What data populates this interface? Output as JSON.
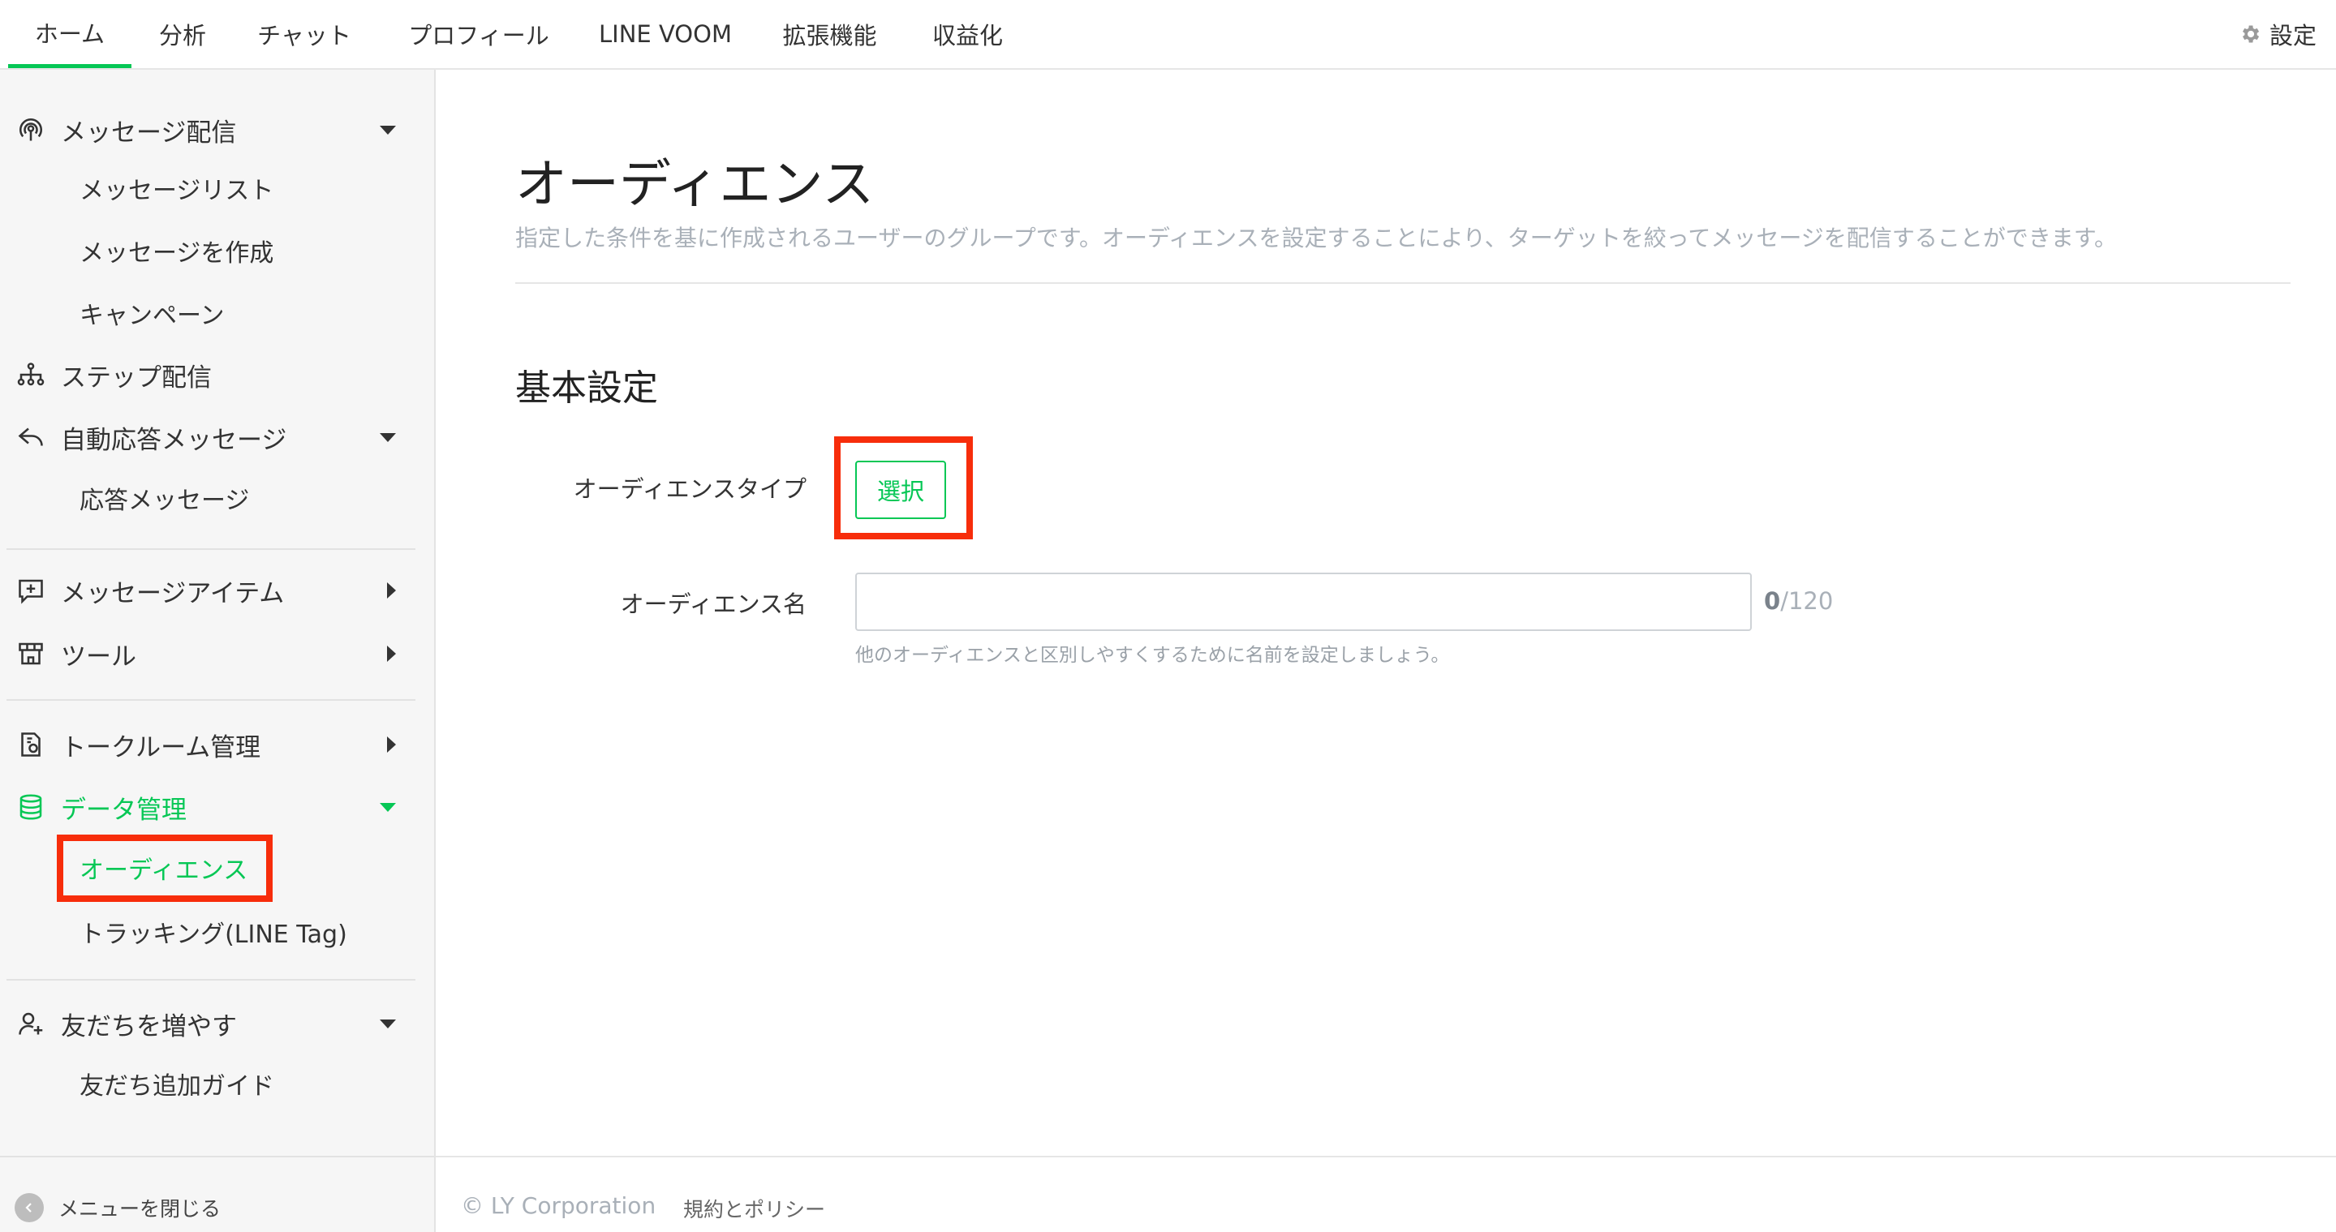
{
  "topnav": {
    "tabs": [
      "ホーム",
      "分析",
      "チャット",
      "プロフィール",
      "LINE VOOM",
      "拡張機能",
      "収益化"
    ],
    "settings_label": "設定"
  },
  "sidebar": {
    "message_delivery": "メッセージ配信",
    "message_list": "メッセージリスト",
    "create_message": "メッセージを作成",
    "campaign": "キャンペーン",
    "step_delivery": "ステップ配信",
    "auto_reply": "自動応答メッセージ",
    "reply_message": "応答メッセージ",
    "message_items": "メッセージアイテム",
    "tools": "ツール",
    "talk_room": "トークルーム管理",
    "data_management": "データ管理",
    "audience": "オーディエンス",
    "tracking": "トラッキング(LINE Tag)",
    "add_friends": "友だちを増やす",
    "friend_guide": "友だち追加ガイド",
    "close_menu": "メニューを閉じる"
  },
  "main": {
    "title": "オーディエンス",
    "description": "指定した条件を基に作成されるユーザーのグループです。オーディエンスを設定することにより、ターゲットを絞ってメッセージを配信することができます。",
    "section_title": "基本設定",
    "audience_type_label": "オーディエンスタイプ",
    "select_button": "選択",
    "audience_name_label": "オーディエンス名",
    "name_value": "",
    "counter_current": "0",
    "counter_max": "/120",
    "hint": "他のオーディエンスと区別しやすくするために名前を設定しましょう。"
  },
  "footer": {
    "copyright": "© LY Corporation",
    "policy": "規約とポリシー"
  },
  "colors": {
    "accent": "#06c755",
    "highlight": "#f72d0b"
  }
}
